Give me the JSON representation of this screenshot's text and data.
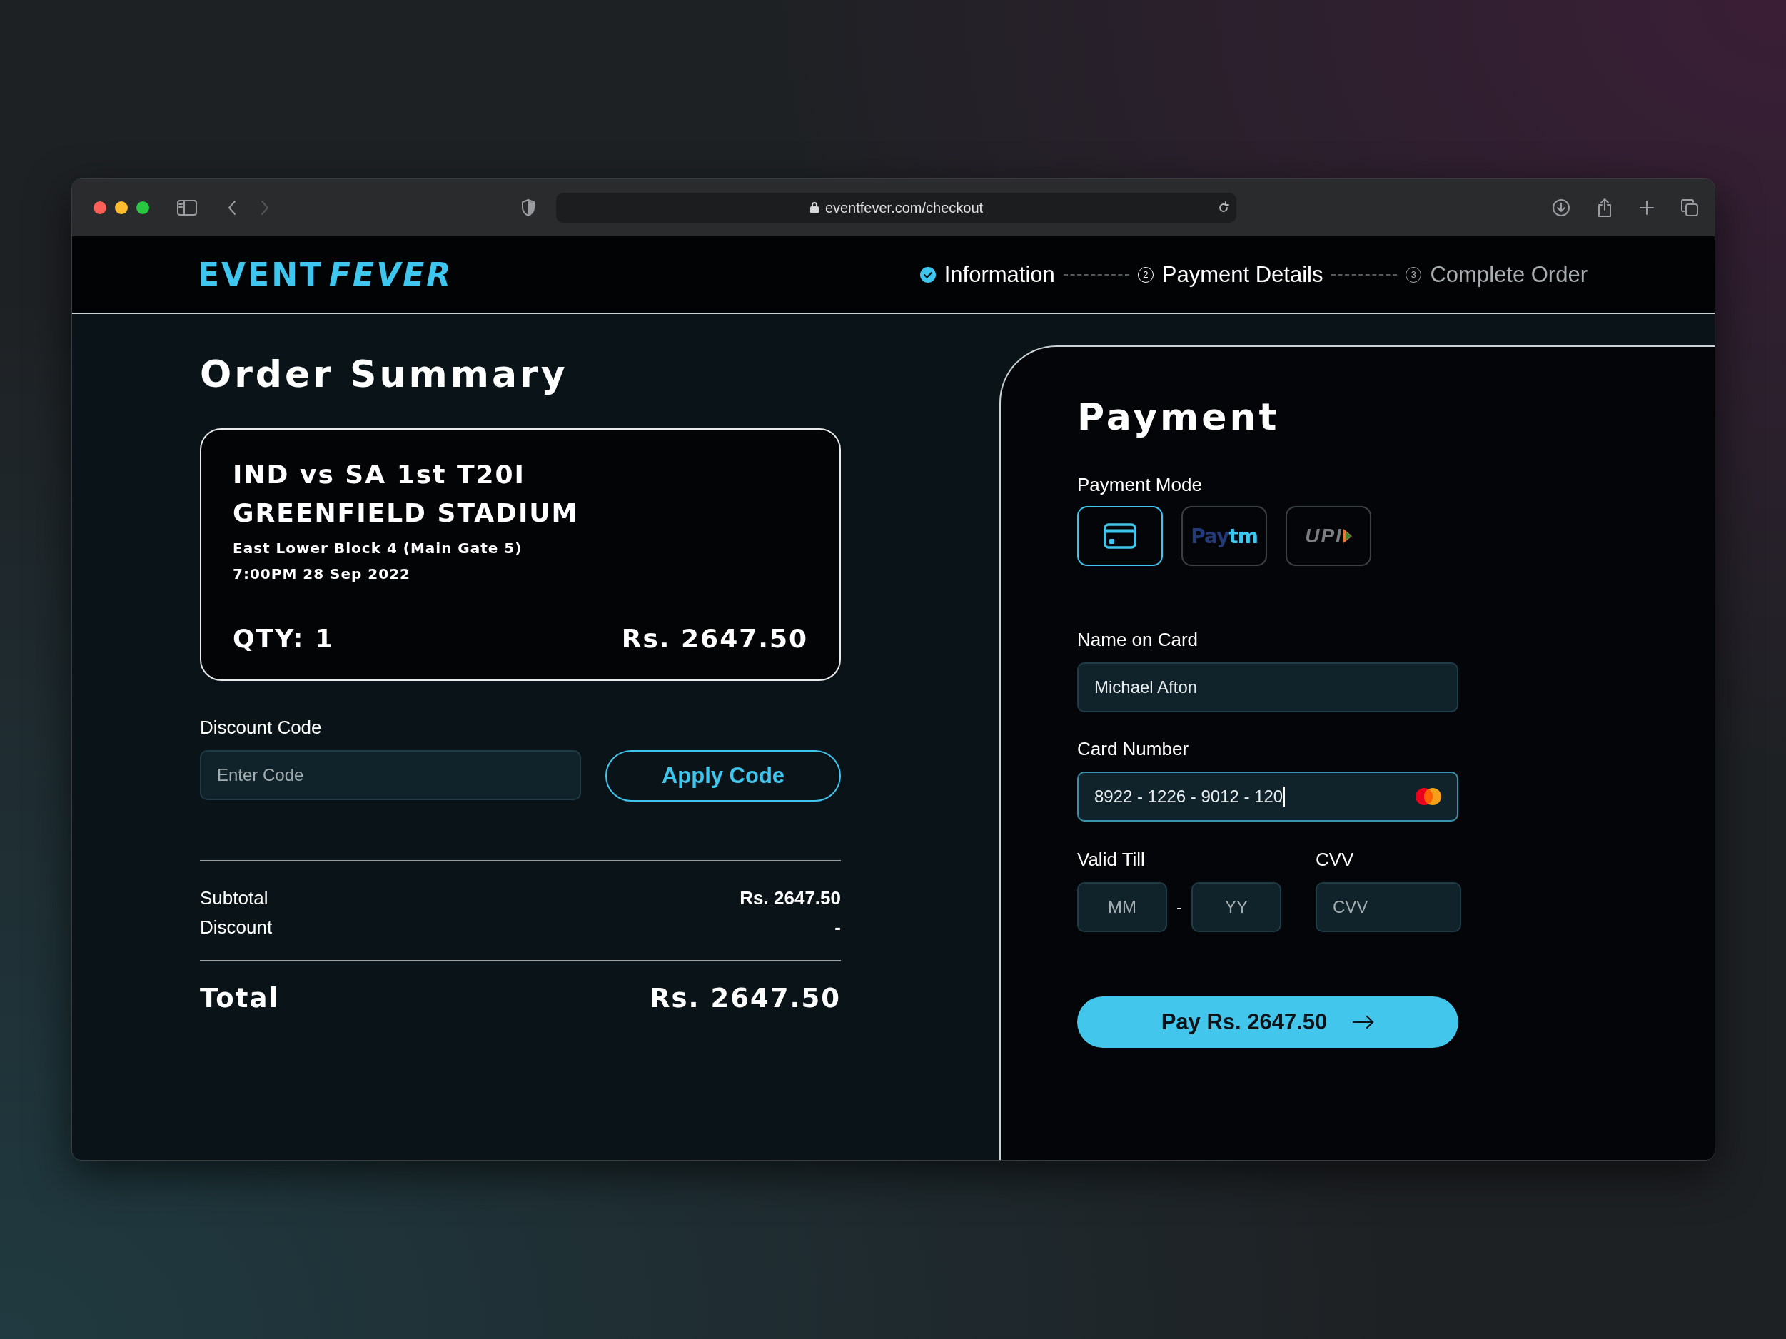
{
  "browser": {
    "url": "eventfever.com/checkout"
  },
  "header": {
    "logo": [
      "EVENT",
      "FEVER"
    ],
    "steps": [
      {
        "label": "Information",
        "completed": true,
        "current": false
      },
      {
        "label": "Payment Details",
        "number": "2",
        "completed": false,
        "current": true
      },
      {
        "label": "Complete Order",
        "number": "3",
        "completed": false,
        "current": false
      }
    ]
  },
  "order_summary": {
    "title": "Order Summary",
    "ticket": {
      "match": "IND vs SA 1st T20I",
      "venue": "GREENFIELD STADIUM",
      "seat": "East Lower Block 4 (Main Gate 5)",
      "datetime": "7:00PM 28 Sep 2022",
      "quantity": "QTY: 1",
      "price": "Rs. 2647.50"
    },
    "discount": {
      "label": "Discount Code",
      "placeholder": "Enter Code",
      "button": "Apply Code"
    },
    "rows": [
      {
        "label": "Subtotal",
        "value": "Rs. 2647.50"
      },
      {
        "label": "Discount",
        "value": "-"
      }
    ],
    "total": {
      "label": "Total",
      "value": "Rs. 2647.50"
    }
  },
  "payment": {
    "title": "Payment",
    "mode_label": "Payment Mode",
    "modes": [
      {
        "kind": "card",
        "selected": true
      },
      {
        "kind": "paytm",
        "logo_text": [
          "Pay",
          "tm"
        ],
        "selected": false
      },
      {
        "kind": "upi",
        "logo_text": [
          "UPI"
        ],
        "selected": false
      }
    ],
    "name_on_card": {
      "label": "Name on Card",
      "value": "Michael Afton"
    },
    "card_number": {
      "label": "Card Number",
      "value": "8922 - 1226 - 9012 - 120",
      "focused": true
    },
    "valid_till": {
      "label": "Valid Till",
      "month_placeholder": "MM",
      "separator": "-",
      "year_placeholder": "YY"
    },
    "cvv": {
      "label": "CVV",
      "placeholder": "CVV"
    },
    "pay_button": "Pay Rs. 2647.50"
  }
}
